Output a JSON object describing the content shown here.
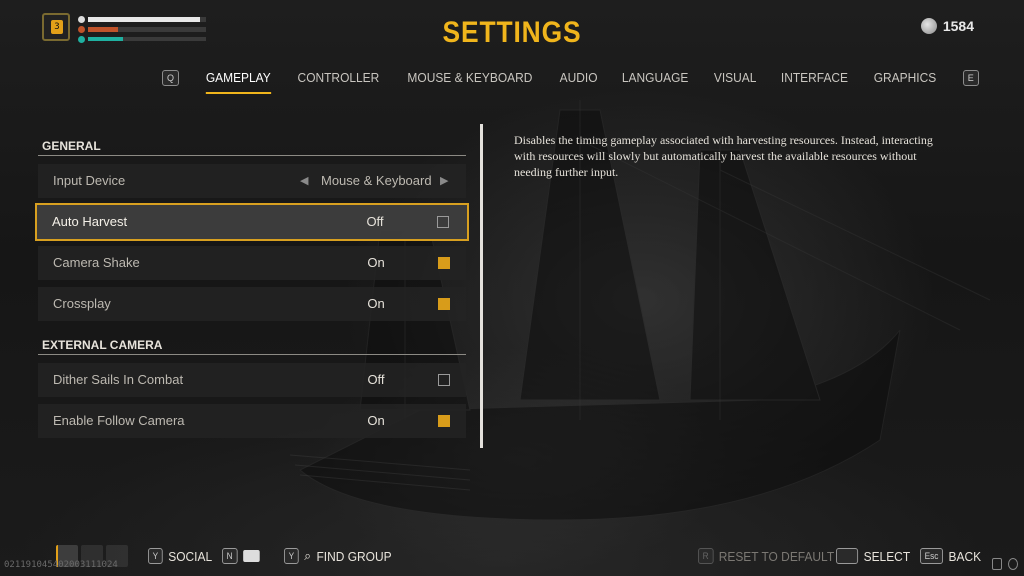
{
  "header": {
    "title": "SETTINGS",
    "coins": "1584",
    "player_level": "3"
  },
  "hud": {
    "health_fraction": 0.95,
    "stamina_fraction": 0.25,
    "xp_fraction": 0.3
  },
  "tabs": {
    "prev_key": "Q",
    "next_key": "E",
    "items": [
      {
        "label": "GAMEPLAY",
        "active": true
      },
      {
        "label": "CONTROLLER"
      },
      {
        "label": "MOUSE & KEYBOARD"
      },
      {
        "label": "AUDIO"
      },
      {
        "label": "LANGUAGE"
      },
      {
        "label": "VISUAL"
      },
      {
        "label": "INTERFACE"
      },
      {
        "label": "GRAPHICS"
      }
    ]
  },
  "general": {
    "header": "GENERAL",
    "input_device": {
      "label": "Input Device",
      "value": "Mouse & Keyboard"
    },
    "auto_harvest": {
      "label": "Auto Harvest",
      "value": "Off",
      "checked": false
    },
    "camera_shake": {
      "label": "Camera Shake",
      "value": "On",
      "checked": true
    },
    "crossplay": {
      "label": "Crossplay",
      "value": "On",
      "checked": true
    }
  },
  "external_camera": {
    "header": "EXTERNAL CAMERA",
    "dither_sails": {
      "label": "Dither Sails In Combat",
      "value": "Off",
      "checked": false
    },
    "follow_camera": {
      "label": "Enable Follow Camera",
      "value": "On",
      "checked": true
    }
  },
  "description": "Disables the timing gameplay associated with harvesting resources. Instead, interacting with resources will slowly but automatically harvest the available resources without needing further input.",
  "bottom": {
    "social_key": "Y",
    "social_label": "SOCIAL",
    "chat_key": "N",
    "group_key": "Y",
    "group_label": "FIND GROUP",
    "reset_key": "R",
    "reset_label": "RESET TO DEFAULT",
    "select_label": "SELECT",
    "back_key": "Esc",
    "back_label": "BACK",
    "build_id": "021191045402003111024"
  },
  "colors": {
    "accent": "#f0b51c",
    "checkbox_on": "#d89c1a"
  }
}
